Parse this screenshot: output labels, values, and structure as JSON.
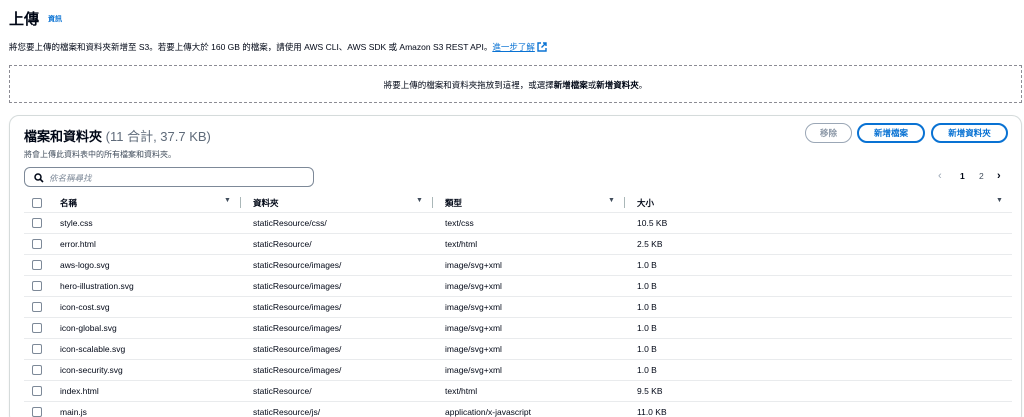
{
  "header": {
    "title": "上傳",
    "info_link": "資訊",
    "description": "將您要上傳的檔案和資料夾新增至 S3。若要上傳大於 160 GB 的檔案，請使用 AWS CLI、AWS SDK 或 Amazon S3 REST API。",
    "learn_more": "進一步了解"
  },
  "dropzone": {
    "text_before": "將要上傳的檔案和資料夾拖放到這裡，或選擇",
    "add_files": "新增檔案",
    "or": "或",
    "add_folder": "新增資料夾",
    "period": "。"
  },
  "panel": {
    "title": "檔案和資料夾",
    "count": "(11 合計, 37.7 KB)",
    "description": "將會上傳此資料表中的所有檔案和資料夾。",
    "remove_label": "移除",
    "add_files_label": "新增檔案",
    "add_folder_label": "新增資料夾",
    "search_placeholder": "依名稱尋找",
    "pagination": {
      "pages": [
        "1",
        "2"
      ],
      "current": "1"
    },
    "columns": [
      "名稱",
      "資料夾",
      "類型",
      "大小"
    ],
    "rows": [
      {
        "name": "style.css",
        "folder": "staticResource/css/",
        "type": "text/css",
        "size": "10.5 KB"
      },
      {
        "name": "error.html",
        "folder": "staticResource/",
        "type": "text/html",
        "size": "2.5 KB"
      },
      {
        "name": "aws-logo.svg",
        "folder": "staticResource/images/",
        "type": "image/svg+xml",
        "size": "1.0 B"
      },
      {
        "name": "hero-illustration.svg",
        "folder": "staticResource/images/",
        "type": "image/svg+xml",
        "size": "1.0 B"
      },
      {
        "name": "icon-cost.svg",
        "folder": "staticResource/images/",
        "type": "image/svg+xml",
        "size": "1.0 B"
      },
      {
        "name": "icon-global.svg",
        "folder": "staticResource/images/",
        "type": "image/svg+xml",
        "size": "1.0 B"
      },
      {
        "name": "icon-scalable.svg",
        "folder": "staticResource/images/",
        "type": "image/svg+xml",
        "size": "1.0 B"
      },
      {
        "name": "icon-security.svg",
        "folder": "staticResource/images/",
        "type": "image/svg+xml",
        "size": "1.0 B"
      },
      {
        "name": "index.html",
        "folder": "staticResource/",
        "type": "text/html",
        "size": "9.5 KB"
      },
      {
        "name": "main.js",
        "folder": "staticResource/js/",
        "type": "application/x-javascript",
        "size": "11.0 KB"
      }
    ]
  },
  "colors": {
    "link": "#0972d3",
    "text": "#000716",
    "border": "#d5dbdb"
  },
  "icons": [
    "external-link-icon",
    "search-icon",
    "sort-caret-icon",
    "chevron-left-icon",
    "chevron-right-icon"
  ]
}
